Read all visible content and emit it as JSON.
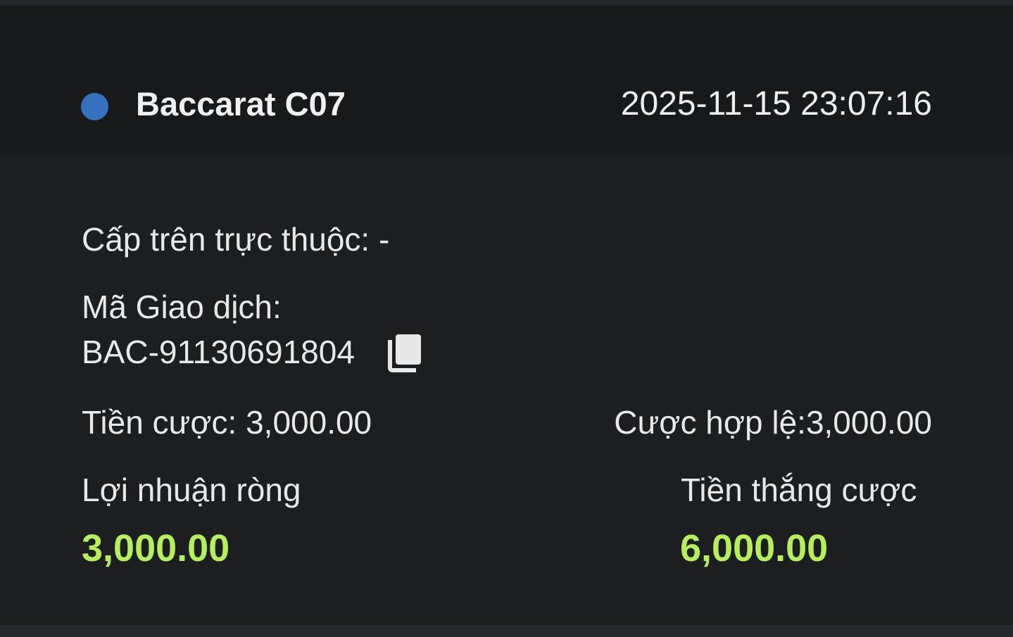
{
  "header": {
    "game_name": "Baccarat C07",
    "timestamp": "2025-11-15 23:07:16",
    "status_color": "#3671c0"
  },
  "details": {
    "agent_label": "Cấp trên trực thuộc:",
    "agent_value": "-",
    "transaction_label": "Mã Giao dịch:",
    "transaction_id": "BAC-91130691804",
    "copy_icon": "copy-icon",
    "stake_label": "Tiền cược:",
    "stake_value": "3,000.00",
    "valid_bet_label": "Cược hợp lệ:",
    "valid_bet_value": "3,000.00"
  },
  "summary": {
    "net_profit_label": "Lợi nhuận ròng",
    "net_profit_value": "3,000.00",
    "winnings_label": "Tiền thắng cược",
    "winnings_value": "6,000.00",
    "amount_color": "#b5f05a"
  }
}
